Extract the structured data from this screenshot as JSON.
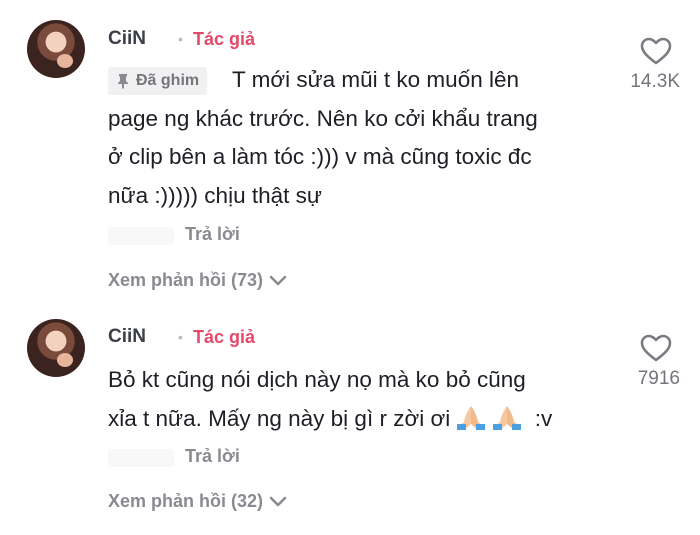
{
  "comments": [
    {
      "username": "CiiN",
      "author_badge": "Tác giả",
      "pinned_label": "Đã ghim",
      "text_line1": "T mới sửa mũi t ko muốn lên",
      "text_line2": "page ng khác trước. Nên ko cởi khẩu trang",
      "text_line3": "ở clip bên a làm tóc :))) v mà cũng toxic đc",
      "text_line4": "nữa :))))) chịu thật sự",
      "reply_label": "Trả lời",
      "view_replies": "Xem phản hồi (73)",
      "like_count": "14.3K",
      "icon": "heart-outline-icon"
    },
    {
      "username": "CiiN",
      "author_badge": "Tác giả",
      "text_line1": "Bỏ kt cũng nói dịch này nọ mà ko bỏ cũng",
      "text_line2": "xỉa t nữa. Mấy ng này bị gì r zời ơi",
      "text_suffix": ":v",
      "emoji": "folded-hands-icon",
      "reply_label": "Trả lời",
      "view_replies": "Xem phản hồi (32)",
      "like_count": "7916",
      "icon": "heart-outline-icon"
    }
  ],
  "colors": {
    "author_badge": "#e5496a",
    "muted": "#8a8b91",
    "text": "#1d1e26"
  }
}
